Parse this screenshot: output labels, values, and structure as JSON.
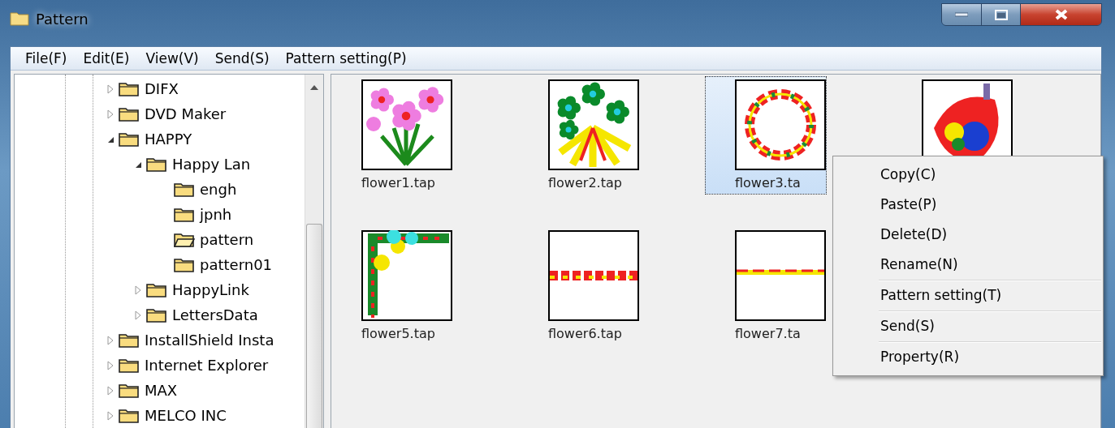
{
  "window": {
    "title": "Pattern"
  },
  "menu_bar": [
    "File(F)",
    "Edit(E)",
    "View(V)",
    "Send(S)",
    "Pattern setting(P)"
  ],
  "tree": [
    {
      "label": "DIFX",
      "expanded": false,
      "selected": false
    },
    {
      "label": "DVD Maker",
      "expanded": false,
      "selected": false
    },
    {
      "label": "HAPPY",
      "expanded": true,
      "selected": false,
      "children": [
        {
          "label": "Happy Lan",
          "expanded": true,
          "selected": false,
          "children": [
            {
              "label": "engh",
              "selected": false
            },
            {
              "label": "jpnh",
              "selected": false
            },
            {
              "label": "pattern",
              "selected": true
            },
            {
              "label": "pattern01",
              "selected": false
            }
          ]
        },
        {
          "label": "HappyLink",
          "expanded": false,
          "selected": false
        },
        {
          "label": "LettersData",
          "expanded": false,
          "selected": false
        }
      ]
    },
    {
      "label": "InstallShield Insta",
      "expanded": false,
      "selected": false
    },
    {
      "label": "Internet Explorer",
      "expanded": false,
      "selected": false
    },
    {
      "label": "MAX",
      "expanded": false,
      "selected": false
    },
    {
      "label": "MELCO INC",
      "expanded": false,
      "selected": false
    }
  ],
  "files": [
    {
      "name": "flower1.tap",
      "kind": "bouquet",
      "selected": false
    },
    {
      "name": "flower2.tap",
      "kind": "spray",
      "selected": false
    },
    {
      "name": "flower3.ta",
      "kind": "wreath",
      "selected": true
    },
    {
      "kind": "cluster",
      "selected": false
    },
    {
      "name": "flower5.tap",
      "kind": "corner",
      "selected": false
    },
    {
      "name": "flower6.tap",
      "kind": "border",
      "selected": false
    },
    {
      "name": "flower7.ta",
      "kind": "line",
      "selected": false
    }
  ],
  "context_menu": [
    [
      "Copy(C)",
      "Paste(P)",
      "Delete(D)",
      "Rename(N)"
    ],
    [
      "Pattern setting(T)"
    ],
    [
      "Send(S)"
    ],
    [
      "Property(R)"
    ]
  ]
}
